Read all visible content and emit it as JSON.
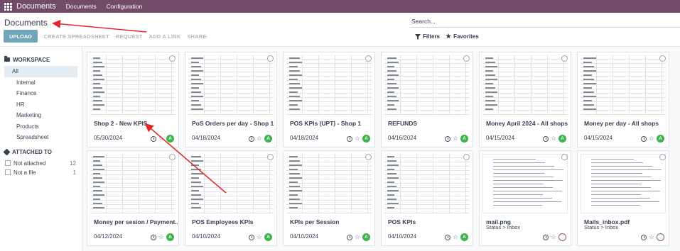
{
  "navbar": {
    "brand": "Documents",
    "items": [
      "Documents",
      "Configuration"
    ]
  },
  "control": {
    "title": "Documents",
    "search_placeholder": "Search...",
    "buttons": {
      "upload": "UPLOAD",
      "create_spreadsheet": "CREATE SPREADSHEET",
      "request": "REQUEST",
      "add_link": "ADD A LINK",
      "share": "SHARE"
    },
    "filters": "Filters",
    "favorites": "Favorites"
  },
  "sidebar": {
    "workspace_label": "WORKSPACE",
    "items": [
      "All",
      "Internal",
      "Finance",
      "HR",
      "Marketing",
      "Products",
      "Spreadsheet"
    ],
    "attached_label": "ATTACHED TO",
    "facets": [
      {
        "label": "Not attached",
        "count": "12"
      },
      {
        "label": "Not a file",
        "count": "1"
      }
    ]
  },
  "cards": [
    {
      "name": "Shop 2 - New KPIS",
      "date": "05/30/2024",
      "kind": "sheet",
      "avatar": "A"
    },
    {
      "name": "PoS Orders per day - Shop 1",
      "date": "04/18/2024",
      "kind": "sheet",
      "avatar": "A"
    },
    {
      "name": "POS KPIs (UPT) - Shop 1",
      "date": "04/18/2024",
      "kind": "sheet",
      "avatar": "A"
    },
    {
      "name": "REFUNDS",
      "date": "04/16/2024",
      "kind": "sheet",
      "avatar": "A"
    },
    {
      "name": "Money April 2024 - All shops",
      "date": "04/15/2024",
      "kind": "sheet",
      "avatar": "A"
    },
    {
      "name": "Money per day - All shops",
      "date": "04/15/2024",
      "kind": "sheet",
      "avatar": "A"
    },
    {
      "name": "Money per sesion / Payment...",
      "date": "04/12/2024",
      "kind": "sheet",
      "avatar": "A"
    },
    {
      "name": "POS Employees KPIs",
      "date": "04/10/2024",
      "kind": "sheet",
      "avatar": "A"
    },
    {
      "name": "KPIs per Session",
      "date": "04/10/2024",
      "kind": "sheet",
      "avatar": "A"
    },
    {
      "name": "POS KPIs",
      "date": "04/10/2024",
      "kind": "sheet",
      "avatar": "A"
    },
    {
      "name": "mail.png",
      "sub": "Status > Inbox",
      "kind": "doc"
    },
    {
      "name": "Mails_inbox.pdf",
      "sub": "Status > Inbox",
      "kind": "doc"
    }
  ]
}
